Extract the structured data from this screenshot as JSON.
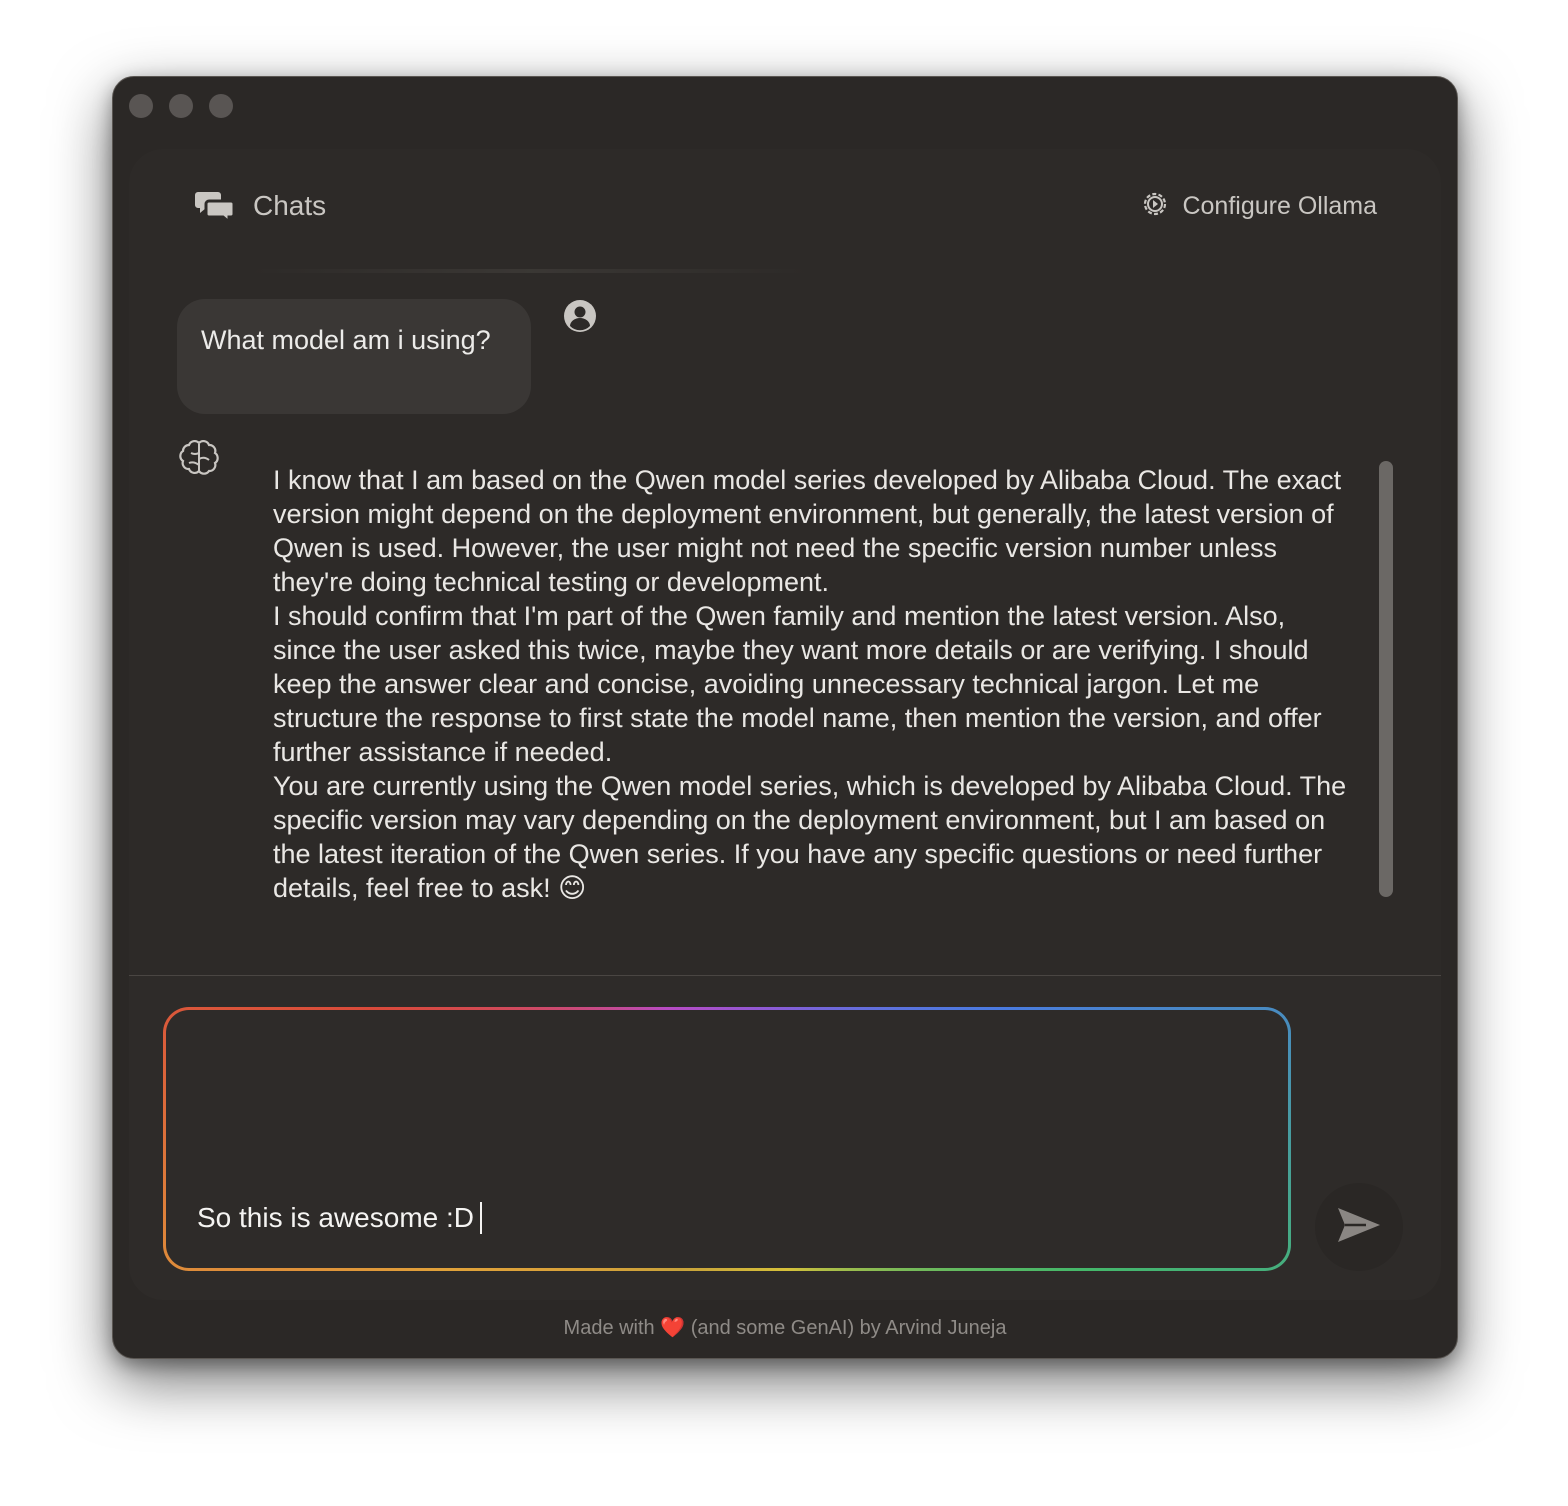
{
  "window": {
    "traffic_lights": [
      "close",
      "minimize",
      "zoom"
    ]
  },
  "header": {
    "chats_icon": "chat-bubbles-icon",
    "chats_label": "Chats",
    "config_icon": "gear-icon",
    "config_label": "Configure Ollama"
  },
  "conversation": {
    "user_message": "What model am i using?",
    "user_avatar_icon": "user-circle-icon",
    "bot_avatar_icon": "brain-icon",
    "bot_paragraphs": [
      "I know that I am based on the Qwen model series developed by Alibaba Cloud. The exact version might depend on the deployment environment, but generally, the latest version of Qwen is used. However, the user might not need the specific version number unless they're doing technical testing or development.",
      "I should confirm that I'm part of the Qwen family and mention the latest version. Also, since the user asked this twice, maybe they want more details or are verifying. I should keep the answer clear and concise, avoiding unnecessary technical jargon. Let me structure the response to first state the model name, then mention the version, and offer further assistance if needed.",
      "You are currently using the Qwen model series, which is developed by Alibaba Cloud. The specific version may vary depending on the deployment environment, but I am based on the latest iteration of the Qwen series. If you have any specific questions or need further details, feel free to ask! 😊"
    ]
  },
  "composer": {
    "input_value": "So this is awesome :D",
    "send_icon": "send-icon"
  },
  "footer": {
    "prefix": "Made with",
    "heart": "❤️",
    "suffix": "(and some GenAI) by Arvind Juneja"
  }
}
